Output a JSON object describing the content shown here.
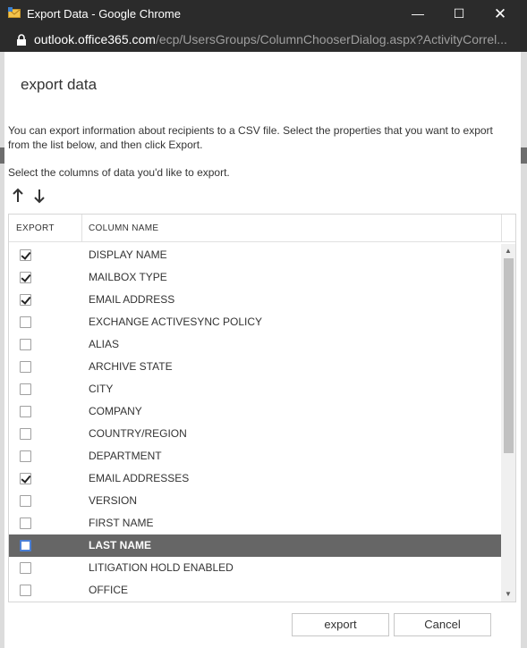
{
  "window": {
    "title": "Export Data - Google Chrome",
    "min_glyph": "—",
    "max_glyph": "☐",
    "close_glyph": "✕"
  },
  "address": {
    "host": "outlook.office365.com",
    "path": "/ecp/UsersGroups/ColumnChooserDialog.aspx?ActivityCorrel..."
  },
  "dialog": {
    "title": "export data",
    "intro": "You can export information about recipients to a CSV file. Select the properties that you want to export from the list below, and then click Export.",
    "select_prompt": "Select the columns of data you'd like to export."
  },
  "grid": {
    "col_export": "EXPORT",
    "col_name": "COLUMN NAME",
    "rows": [
      {
        "label": "DISPLAY NAME",
        "checked": true,
        "selected": false
      },
      {
        "label": "MAILBOX TYPE",
        "checked": true,
        "selected": false
      },
      {
        "label": "EMAIL ADDRESS",
        "checked": true,
        "selected": false
      },
      {
        "label": "EXCHANGE ACTIVESYNC POLICY",
        "checked": false,
        "selected": false
      },
      {
        "label": "ALIAS",
        "checked": false,
        "selected": false
      },
      {
        "label": "ARCHIVE STATE",
        "checked": false,
        "selected": false
      },
      {
        "label": "CITY",
        "checked": false,
        "selected": false
      },
      {
        "label": "COMPANY",
        "checked": false,
        "selected": false
      },
      {
        "label": "COUNTRY/REGION",
        "checked": false,
        "selected": false
      },
      {
        "label": "DEPARTMENT",
        "checked": false,
        "selected": false
      },
      {
        "label": "EMAIL ADDRESSES",
        "checked": true,
        "selected": false
      },
      {
        "label": "VERSION",
        "checked": false,
        "selected": false
      },
      {
        "label": "FIRST NAME",
        "checked": false,
        "selected": false
      },
      {
        "label": "LAST NAME",
        "checked": false,
        "selected": true
      },
      {
        "label": "LITIGATION HOLD ENABLED",
        "checked": false,
        "selected": false
      },
      {
        "label": "OFFICE",
        "checked": false,
        "selected": false
      }
    ]
  },
  "buttons": {
    "export": "export",
    "cancel": "Cancel"
  },
  "icons": {
    "app": "outlook-envelope-icon",
    "lock": "lock-icon",
    "move_up": "arrow-up-icon",
    "move_down": "arrow-down-icon"
  },
  "colors": {
    "titlebar": "#2b2b2b",
    "selected_row": "#666666",
    "selected_checkbox_border": "#4a7fd6"
  }
}
